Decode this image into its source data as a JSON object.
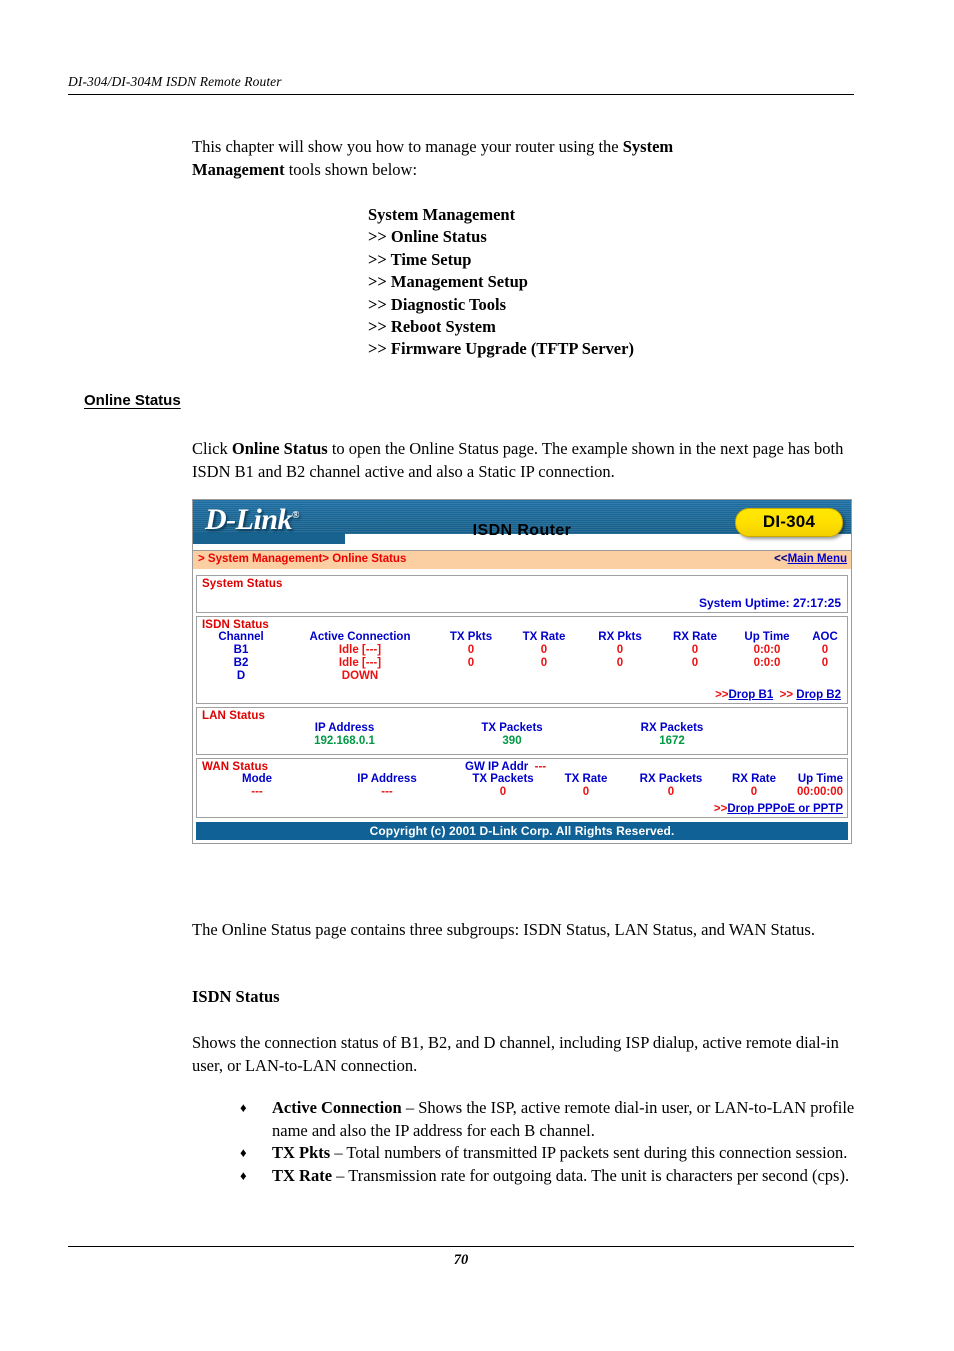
{
  "page": {
    "header": "DI-304/DI-304M ISDN Remote Router",
    "number": "70"
  },
  "intro": {
    "p1_a": "This chapter will show you how to manage your router using the ",
    "p1_b": "System Management",
    "p1_c": " tools shown below:"
  },
  "menu": {
    "title": "System Management",
    "items": [
      ">> Online Status",
      ">> Time Setup",
      ">> Management Setup",
      ">> Diagnostic Tools",
      ">> Reboot System",
      ">> Firmware Upgrade (TFTP Server)"
    ]
  },
  "section": {
    "heading": "Online Status",
    "click_a": "Click ",
    "click_b": "Online Status",
    "click_c": " to open the Online Status page. The example shown in the next page has both ISDN B1 and B2 channel active and also a Static IP connection."
  },
  "after": {
    "subgroups": "The Online Status page contains three subgroups: ISDN Status, LAN Status, and WAN Status.",
    "isdn_heading": "ISDN Status",
    "shows": "Shows the connection status of B1, B2, and D channel, including ISP dialup, active remote dial-in user, or LAN-to-LAN connection.",
    "bullets": [
      {
        "mark": "♦",
        "term": "Active Connection",
        "dash": " – ",
        "desc": "Shows the ISP, active remote dial-in user, or LAN-to-LAN profile name and also the IP address for each B channel."
      },
      {
        "mark": "♦",
        "term": "TX Pkts",
        "dash": " – ",
        "desc": "Total numbers of transmitted IP packets sent during this connection session."
      },
      {
        "mark": "♦",
        "term": "TX Rate",
        "dash": " – ",
        "desc": "Transmission rate for outgoing data. The unit is characters per second (cps)."
      }
    ]
  },
  "router": {
    "brand": "D-Link",
    "brand_mark": "®",
    "model_title": "ISDN Router",
    "badge": "DI-304",
    "breadcrumb": "> System Management> Online Status",
    "main_menu_arrows": "<<",
    "main_menu_label": "Main Menu",
    "system_status": {
      "title": "System Status",
      "uptime": "System Uptime: 27:17:25"
    },
    "isdn_status": {
      "title": "ISDN Status",
      "headers": [
        "Channel",
        "Active Connection",
        "TX Pkts",
        "TX Rate",
        "RX Pkts",
        "RX Rate",
        "Up Time",
        "AOC"
      ],
      "rows": [
        {
          "channel": "B1",
          "connection": "Idle [---]",
          "tx_pkts": "0",
          "tx_rate": "0",
          "rx_pkts": "0",
          "rx_rate": "0",
          "up_time": "0:0:0",
          "aoc": "0"
        },
        {
          "channel": "B2",
          "connection": "Idle [---]",
          "tx_pkts": "0",
          "tx_rate": "0",
          "rx_pkts": "0",
          "rx_rate": "0",
          "up_time": "0:0:0",
          "aoc": "0"
        },
        {
          "channel": "D",
          "connection": "DOWN",
          "tx_pkts": "",
          "tx_rate": "",
          "rx_pkts": "",
          "rx_rate": "",
          "up_time": "",
          "aoc": ""
        }
      ],
      "drop_arrow_1": ">>",
      "drop_b1": "Drop B1",
      "drop_arrow_2": ">>",
      "drop_b2": "Drop B2"
    },
    "lan_status": {
      "title": "LAN Status",
      "headers": [
        "IP Address",
        "TX Packets",
        "RX Packets"
      ],
      "row": {
        "ip_address": "192.168.0.1",
        "tx_packets": "390",
        "rx_packets": "1672"
      }
    },
    "wan_status": {
      "title": "WAN Status",
      "gw_label": "GW IP Addr",
      "gw_value": "---",
      "headers": [
        "Mode",
        "IP Address",
        "TX Packets",
        "TX Rate",
        "RX Packets",
        "RX Rate",
        "Up Time"
      ],
      "row": {
        "mode": "---",
        "ip_address": "---",
        "tx_packets": "0",
        "tx_rate": "0",
        "rx_packets": "0",
        "rx_rate": "0",
        "up_time": "00:00:00"
      },
      "drop_arrow": ">>",
      "drop_link": "Drop PPPoE or PPTP"
    },
    "footer": "Copyright (c) 2001 D-Link Corp. All Rights Reserved."
  },
  "colors": {
    "banner_blue": "#17628f",
    "badge_yellow": "#ffe000",
    "crumb_bg": "#fbcfa2",
    "red": "#ee1111",
    "blue": "#0000cc",
    "green": "#009944",
    "footer_blue": "#0f6196"
  }
}
